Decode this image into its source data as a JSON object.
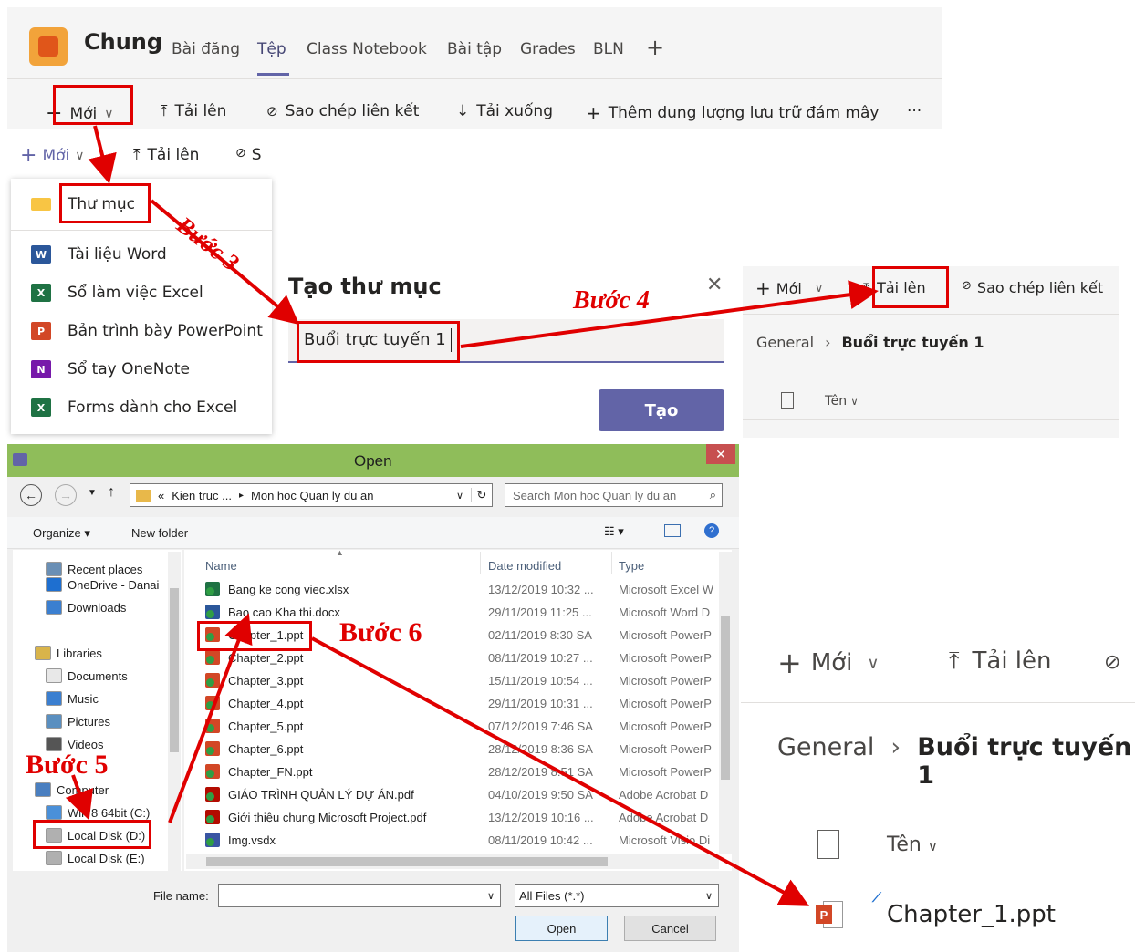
{
  "teams_header": {
    "channel": "Chung",
    "tabs": [
      "Bài đăng",
      "Tệp",
      "Class Notebook",
      "Bài tập",
      "Grades",
      "BLN"
    ],
    "active_tab": "Tệp",
    "add_tab": "+"
  },
  "toolbar": {
    "new_label": "Mới",
    "upload_label": "Tải lên",
    "copy_link_label": "Sao chép liên kết",
    "download_label": "Tải xuống",
    "cloud_storage_label": "Thêm dung lượng lưu trữ đám mây",
    "more": "···"
  },
  "toolbar_small": {
    "new_label": "Mới",
    "upload_label": "Tải lên",
    "copy_partial": "S"
  },
  "new_menu": {
    "items": [
      {
        "label": "Thư mục",
        "icon": "folder-icon"
      },
      {
        "label": "Tài liệu Word",
        "icon": "word-icon"
      },
      {
        "label": "Sổ làm việc Excel",
        "icon": "excel-icon"
      },
      {
        "label": "Bản trình bày PowerPoint",
        "icon": "powerpoint-icon"
      },
      {
        "label": "Sổ tay OneNote",
        "icon": "onenote-icon"
      },
      {
        "label": "Forms dành cho Excel",
        "icon": "forms-excel-icon"
      }
    ]
  },
  "create_folder": {
    "title": "Tạo thư mục",
    "input_value": "Buổi trực tuyến 1",
    "create_button": "Tạo",
    "close": "✕"
  },
  "folder_view": {
    "new_label": "Mới",
    "upload_label": "Tải lên",
    "copy_link_label": "Sao chép liên kết",
    "breadcrumb_root": "General",
    "breadcrumb_current": "Buổi trực tuyến 1",
    "name_header": "Tên"
  },
  "folder_view_large": {
    "new_label": "Mới",
    "upload_label": "Tải lên",
    "breadcrumb_root": "General",
    "breadcrumb_current": "Buổi trực tuyến 1",
    "name_header": "Tên",
    "file_name": "Chapter_1.ppt"
  },
  "open_dialog": {
    "title": "Open",
    "path": [
      "«",
      "Kien truc ...",
      "Mon hoc Quan ly du an"
    ],
    "search_placeholder": "Search Mon hoc Quan ly du an",
    "organize": "Organize ▾",
    "new_folder": "New folder",
    "nav": [
      {
        "label": "Recent places",
        "color": "#6a8fb5"
      },
      {
        "label": "OneDrive - Danai",
        "color": "#1e6fd0"
      },
      {
        "label": "Downloads",
        "color": "#3b7fd0"
      },
      {
        "label": "Libraries",
        "color": "#d9b44a"
      },
      {
        "label": "Documents",
        "color": "#e8e8e8"
      },
      {
        "label": "Music",
        "color": "#3b7fd0"
      },
      {
        "label": "Pictures",
        "color": "#5a8fc0"
      },
      {
        "label": "Videos",
        "color": "#555"
      },
      {
        "label": "Computer",
        "color": "#4a7fc0"
      },
      {
        "label": "Win 8 64bit (C:)",
        "color": "#4a90d9"
      },
      {
        "label": "Local Disk (D:)",
        "color": "#b0b0b0"
      },
      {
        "label": "Local Disk (E:)",
        "color": "#b0b0b0"
      }
    ],
    "columns": [
      "Name",
      "Date modified",
      "Type"
    ],
    "files": [
      {
        "name": "Bang ke cong viec.xlsx",
        "date": "13/12/2019 10:32 ...",
        "type": "Microsoft Excel W",
        "color": "#1f7244"
      },
      {
        "name": "Bao cao Kha thi.docx",
        "date": "29/11/2019 11:25 ...",
        "type": "Microsoft Word D",
        "color": "#2b579a"
      },
      {
        "name": "Chapter_1.ppt",
        "date": "02/11/2019 8:30 SA",
        "type": "Microsoft PowerP",
        "color": "#d24726"
      },
      {
        "name": "Chapter_2.ppt",
        "date": "08/11/2019 10:27 ...",
        "type": "Microsoft PowerP",
        "color": "#d24726"
      },
      {
        "name": "Chapter_3.ppt",
        "date": "15/11/2019 10:54 ...",
        "type": "Microsoft PowerP",
        "color": "#d24726"
      },
      {
        "name": "Chapter_4.ppt",
        "date": "29/11/2019 10:31 ...",
        "type": "Microsoft PowerP",
        "color": "#d24726"
      },
      {
        "name": "Chapter_5.ppt",
        "date": "07/12/2019 7:46 SA",
        "type": "Microsoft PowerP",
        "color": "#d24726"
      },
      {
        "name": "Chapter_6.ppt",
        "date": "28/12/2019 8:36 SA",
        "type": "Microsoft PowerP",
        "color": "#d24726"
      },
      {
        "name": "Chapter_FN.ppt",
        "date": "28/12/2019 8:51 SA",
        "type": "Microsoft PowerP",
        "color": "#d24726"
      },
      {
        "name": "GIÁO TRÌNH QUẢN LÝ DỰ ÁN.pdf",
        "date": "04/10/2019 9:50 SA",
        "type": "Adobe Acrobat D",
        "color": "#b30b00"
      },
      {
        "name": "Giới thiệu chung Microsoft Project.pdf",
        "date": "13/12/2019 10:16 ...",
        "type": "Adobe Acrobat D",
        "color": "#b30b00"
      },
      {
        "name": "Img.vsdx",
        "date": "08/11/2019 10:42 ...",
        "type": "Microsoft Visio Di",
        "color": "#3955a3"
      }
    ],
    "file_name_label": "File name:",
    "file_type": "All Files (*.*)",
    "open_button": "Open",
    "cancel_button": "Cancel"
  },
  "steps": {
    "step3": "Bước 3",
    "step4": "Bước 4",
    "step5": "Bước 5",
    "step6": "Bước 6"
  },
  "colors": {
    "teams_purple": "#6264a7",
    "annotation_red": "#e00000",
    "dialog_title_green": "#8fbd5a"
  }
}
